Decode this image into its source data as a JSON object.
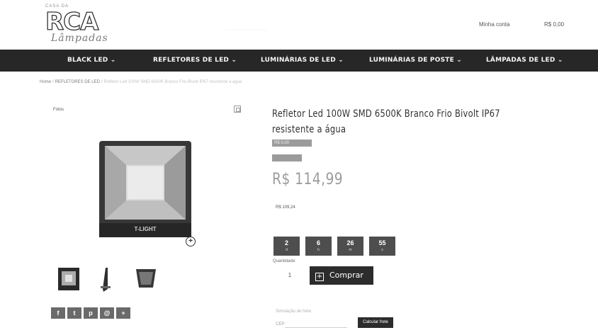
{
  "header": {
    "logo_top": "CASA DA",
    "logo_mark": "RCA",
    "logo_sub": "Lâmpadas",
    "contact_text": "· · · · · · · · · · · · · ·",
    "account_label": "Minha conta",
    "cart_label": "R$ 0,00"
  },
  "nav": {
    "items": [
      {
        "label": "BLACK LED ⌄"
      },
      {
        "label": "REFLETORES DE LED ⌄"
      },
      {
        "label": "LUMINÁRIAS DE LED ⌄"
      },
      {
        "label": "LUMINÁRIAS DE POSTE ⌄"
      },
      {
        "label": "LÂMPADAS DE LED ⌄"
      }
    ]
  },
  "breadcrumb": {
    "home": "Home",
    "category": "REFLETORES DE LED",
    "current": "Refletor Led 100W SMD 6500K Branco Frio Bivolt IP67 resistente a água"
  },
  "gallery": {
    "fotos_label": "Fotos",
    "main_photo_label": "T-LIGHT",
    "social": [
      "f",
      "t",
      "p",
      "@",
      "+"
    ]
  },
  "product": {
    "title": "Refletor Led 100W SMD 6500K Branco Frio Bivolt IP67 resistente a água",
    "badge1": "R$ 0,00",
    "badge2": "",
    "price_label": "",
    "price": "R$ 114,99",
    "price_line1": "",
    "price_line2": "",
    "price_line3": "R$ 109,24",
    "price_line4": "",
    "promo_label": "",
    "countdown": [
      {
        "value": "2",
        "unit": "d"
      },
      {
        "value": "6",
        "unit": "h"
      },
      {
        "value": "26",
        "unit": "m"
      },
      {
        "value": "55",
        "unit": "s"
      }
    ],
    "qty_label": "Quantidade:",
    "qty_value": "1",
    "buy_label": "Comprar",
    "frete_label": "Simulação de frete",
    "cep_label": "CEP:",
    "cep_placeholder": "",
    "calc_label": "Calcular frete"
  }
}
